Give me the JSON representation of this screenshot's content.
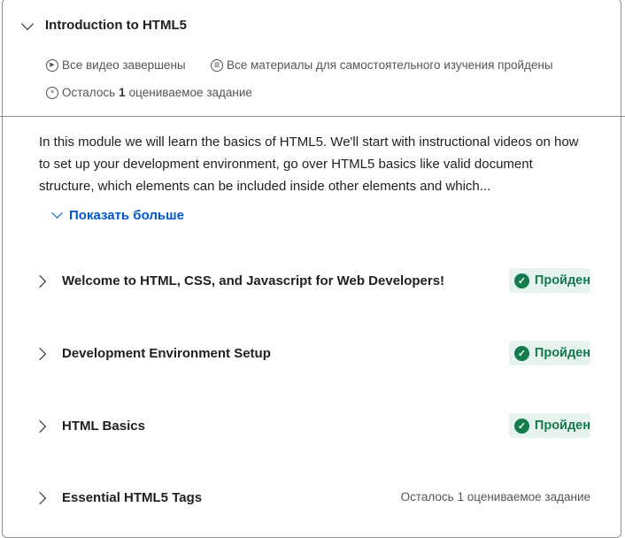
{
  "module": {
    "title": "Introduction to HTML5",
    "meta": {
      "videos": "Все видео завершены",
      "materials": "Все материалы для самостоятельного изучения пройдены",
      "remaining_prefix": "Осталось",
      "remaining_count": "1",
      "remaining_suffix": "оцениваемое задание"
    },
    "description": "In this module we will learn the basics of HTML5. We'll start with instructional videos on how to set up your development environment, go over HTML5 basics like valid document structure, which elements can be included inside other elements and which...",
    "show_more": "Показать больше"
  },
  "items": [
    {
      "title": "Welcome to HTML, CSS, and Javascript for Web Developers!",
      "status": "Пройден"
    },
    {
      "title": "Development Environment Setup",
      "status": "Пройден"
    },
    {
      "title": "HTML Basics",
      "status": "Пройден"
    },
    {
      "title": "Essential HTML5 Tags",
      "status": "Осталось 1 оцениваемое задание"
    }
  ],
  "colors": {
    "accent": "#0056d2",
    "success": "#137b4c",
    "success_bg": "#e6f3ee"
  }
}
